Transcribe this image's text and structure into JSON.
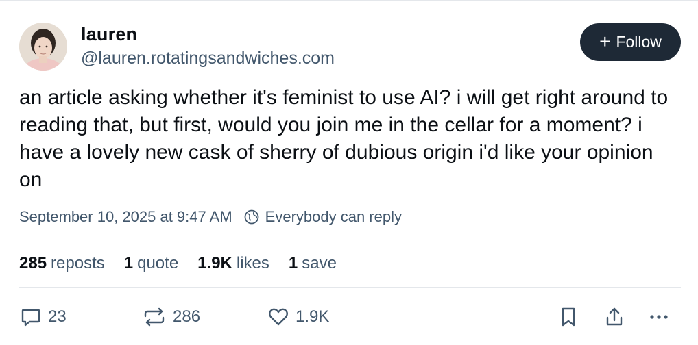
{
  "author": {
    "display_name": "lauren",
    "handle": "@lauren.rotatingsandwiches.com"
  },
  "follow_button": {
    "label": "Follow",
    "icon": "plus-icon"
  },
  "post": {
    "text": "an article asking whether it's feminist to use AI? i will get right around to reading that, but first, would you join me in the cellar for a moment? i have a lovely new cask of sherry of dubious origin i'd like your opinion on",
    "timestamp": "September 10, 2025 at 9:47 AM",
    "reply_setting": "Everybody can reply"
  },
  "stats": {
    "reposts": {
      "count": "285",
      "label": "reposts"
    },
    "quotes": {
      "count": "1",
      "label": "quote"
    },
    "likes": {
      "count": "1.9K",
      "label": "likes"
    },
    "saves": {
      "count": "1",
      "label": "save"
    }
  },
  "actions": {
    "reply_count": "23",
    "repost_count": "286",
    "like_count": "1.9K"
  },
  "colors": {
    "follow_bg": "#1e2936",
    "muted_text": "#42576c",
    "divider": "#e4e7eb"
  }
}
